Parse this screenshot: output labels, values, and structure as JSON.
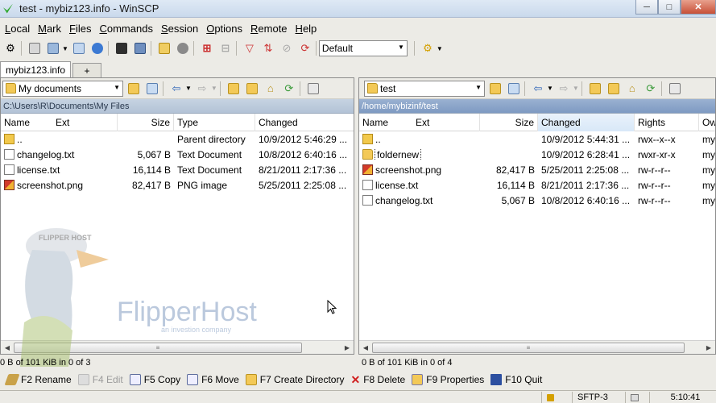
{
  "window": {
    "title": "test - mybiz123.info - WinSCP"
  },
  "menu": [
    "Local",
    "Mark",
    "Files",
    "Commands",
    "Session",
    "Options",
    "Remote",
    "Help"
  ],
  "toolbar": {
    "transfer_preset": "Default"
  },
  "tabs": {
    "session": "mybiz123.info",
    "new": "+"
  },
  "left": {
    "location": "My documents",
    "path": "C:\\Users\\R\\Documents\\My Files",
    "columns": {
      "name": "Name",
      "ext": "Ext",
      "size": "Size",
      "type": "Type",
      "changed": "Changed"
    },
    "rows": [
      {
        "name": "..",
        "size": "",
        "type": "Parent directory",
        "changed": "10/9/2012  5:46:29 ..."
      },
      {
        "name": "changelog.txt",
        "size": "5,067 B",
        "type": "Text Document",
        "changed": "10/8/2012  6:40:16 ..."
      },
      {
        "name": "license.txt",
        "size": "16,114 B",
        "type": "Text Document",
        "changed": "8/21/2011  2:17:36 ..."
      },
      {
        "name": "screenshot.png",
        "size": "82,417 B",
        "type": "PNG image",
        "changed": "5/25/2011  2:25:08 ..."
      }
    ],
    "status": "0 B of 101 KiB in 0 of 3"
  },
  "right": {
    "location": "test",
    "path": "/home/mybizinf/test",
    "columns": {
      "name": "Name",
      "ext": "Ext",
      "size": "Size",
      "changed": "Changed",
      "rights": "Rights",
      "owner": "Ow"
    },
    "rows": [
      {
        "name": "..",
        "size": "",
        "changed": "10/9/2012  5:44:31 ...",
        "rights": "rwx--x--x",
        "owner": "my"
      },
      {
        "name": "foldernew",
        "size": "",
        "changed": "10/9/2012  6:28:41 ...",
        "rights": "rwxr-xr-x",
        "owner": "my"
      },
      {
        "name": "screenshot.png",
        "size": "82,417 B",
        "changed": "5/25/2011  2:25:08 ...",
        "rights": "rw-r--r--",
        "owner": "my"
      },
      {
        "name": "license.txt",
        "size": "16,114 B",
        "changed": "8/21/2011  2:17:36 ...",
        "rights": "rw-r--r--",
        "owner": "my"
      },
      {
        "name": "changelog.txt",
        "size": "5,067 B",
        "changed": "10/8/2012  6:40:16 ...",
        "rights": "rw-r--r--",
        "owner": "my"
      }
    ],
    "status": "0 B of 101 KiB in 0 of 4"
  },
  "fkeys": {
    "rename": "F2 Rename",
    "edit": "F4 Edit",
    "copy": "F5 Copy",
    "move": "F6 Move",
    "mkdir": "F7 Create Directory",
    "delete": "F8 Delete",
    "properties": "F9 Properties",
    "quit": "F10 Quit"
  },
  "bottom": {
    "protocol": "SFTP-3",
    "time": "5:10:41"
  },
  "watermark": {
    "brand": "FlipperHost",
    "tagline": "an investion company",
    "cap_text": "FLIPPER HOST"
  }
}
